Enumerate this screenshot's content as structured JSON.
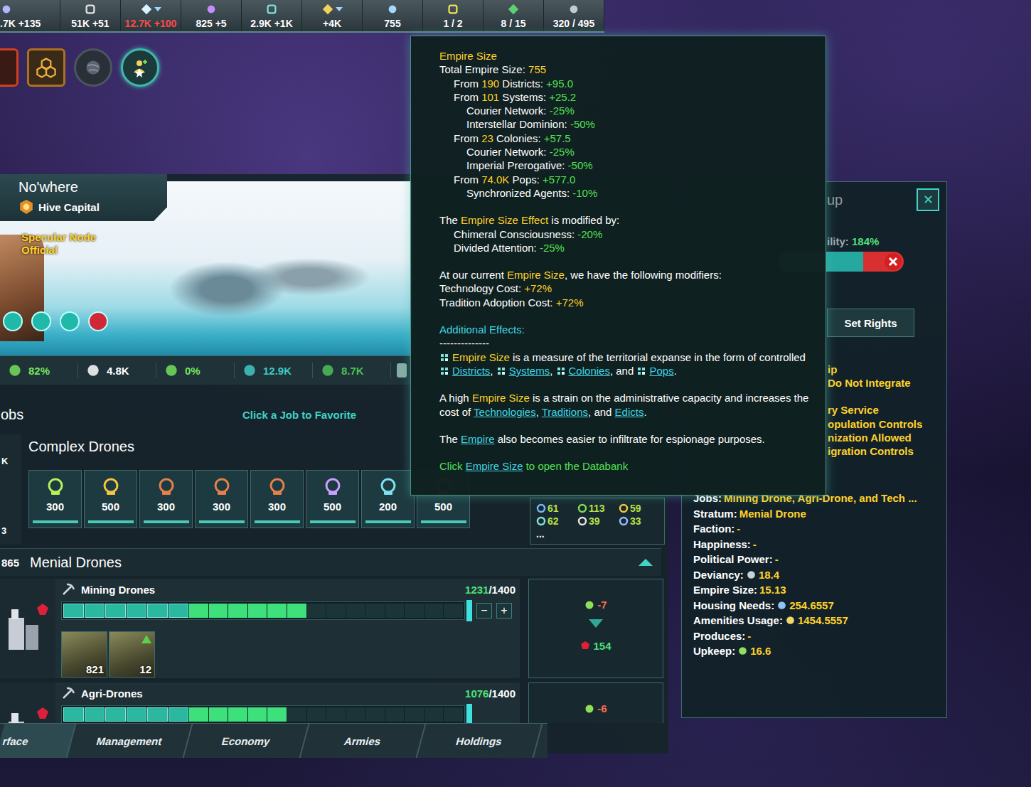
{
  "resources": [
    {
      "text": ".7K +135",
      "warning": false,
      "dropdown": false
    },
    {
      "text": "51K +51",
      "warning": false,
      "dropdown": false
    },
    {
      "text": "12.7K +100",
      "warning": true,
      "dropdown": true
    },
    {
      "text": "825 +5",
      "warning": false,
      "dropdown": false
    },
    {
      "text": "2.9K +1K",
      "warning": false,
      "dropdown": false
    },
    {
      "text": "+4K",
      "warning": false,
      "dropdown": true
    },
    {
      "text": "755",
      "warning": false,
      "dropdown": false
    },
    {
      "text": "1 / 2",
      "warning": false,
      "dropdown": false
    },
    {
      "text": "8 / 15",
      "warning": false,
      "dropdown": false
    },
    {
      "text": "320 / 495",
      "warning": false,
      "dropdown": false
    }
  ],
  "planet": {
    "name": "No'where",
    "designation": "Hive Capital",
    "leader": "Specular Node Official",
    "stats": [
      {
        "text": "82%",
        "color": "#74e25c"
      },
      {
        "text": "4.8K",
        "color": "#ffffff"
      },
      {
        "text": "0%",
        "color": "#74e25c"
      },
      {
        "text": "12.9K",
        "color": "#3fc8c4"
      },
      {
        "text": "8.7K",
        "color": "#4cbf55"
      }
    ]
  },
  "jobs": {
    "title": "obs",
    "hint": "Click a Job to Favorite",
    "side_marks": [
      "K",
      "3"
    ]
  },
  "complex_drones": {
    "title": "Complex Drones",
    "jobs": [
      {
        "count": "300",
        "level": 1
      },
      {
        "count": "500",
        "level": 1
      },
      {
        "count": "300",
        "level": 1
      },
      {
        "count": "300",
        "level": 1
      },
      {
        "count": "300",
        "level": 1
      },
      {
        "count": "500",
        "level": 1
      },
      {
        "count": "200",
        "level": 1
      },
      {
        "count": "500",
        "level": 1
      }
    ],
    "summary": [
      {
        "text": "61",
        "icon": true
      },
      {
        "text": "113",
        "icon": true
      },
      {
        "text": "59",
        "icon": true
      },
      {
        "text": "62",
        "icon": true
      },
      {
        "text": "39",
        "icon": true
      },
      {
        "text": "33",
        "icon": true
      },
      {
        "text": "...",
        "icon": false
      }
    ]
  },
  "menial_drones": {
    "count": "865",
    "title": "Menial Drones",
    "expanded": true,
    "rows": [
      {
        "name": "Mining Drones",
        "filled": "1231",
        "capacity": "/1400",
        "level": 0.6,
        "core_level": 0.3,
        "minus": "−",
        "plus": "+",
        "pops": [
          {
            "count": "821",
            "promoted": false
          },
          {
            "count": "12",
            "promoted": true
          }
        ],
        "upkeep": "-7",
        "output": "154"
      },
      {
        "name": "Agri-Drones",
        "filled": "1076",
        "capacity": "/1400",
        "level": 0.55,
        "core_level": 0.3,
        "pops": [],
        "upkeep": "-6"
      }
    ]
  },
  "tabs": [
    {
      "label": "rface",
      "selected": true
    },
    {
      "label": "Management",
      "selected": false
    },
    {
      "label": "Economy",
      "selected": false
    },
    {
      "label": "Armies",
      "selected": false
    },
    {
      "label": "Holdings",
      "selected": false
    }
  ],
  "pop_group": {
    "close": "✕",
    "title_fragment": "up",
    "habitability_label": "ility: ",
    "habitability_value": "184%",
    "habitability_level": 0.68,
    "rights_button": "Set Rights",
    "policy_fragments": [
      "ip",
      "Do Not Integrate",
      "ry Service",
      "opulation Controls",
      "nization Allowed",
      "igration Controls"
    ],
    "details": [
      {
        "label": "Jobs: ",
        "value": "Mining Drone, Agri-Drone, and Tech ..."
      },
      {
        "label": "Stratum: ",
        "value": "Menial Drone"
      },
      {
        "label": "Faction: ",
        "value": "-"
      },
      {
        "label": "Happiness: ",
        "value": "-"
      },
      {
        "label": "Political Power: ",
        "value": "-"
      },
      {
        "label": "Deviancy: ",
        "value": "18.4"
      },
      {
        "label": "Empire Size: ",
        "value": "15.13"
      },
      {
        "label": "Housing Needs: ",
        "value": "254.6557"
      },
      {
        "label": "Amenities Usage: ",
        "value": "1454.5557"
      },
      {
        "label": "Produces: ",
        "value": "-"
      },
      {
        "label": "Upkeep: ",
        "value": "16.6"
      }
    ]
  },
  "tooltip": {
    "sections": [
      [
        {
          "depth": 0,
          "segs": [
            [
              "hl",
              "Empire Size"
            ]
          ]
        },
        {
          "depth": 0,
          "segs": [
            [
              "t",
              "Total Empire Size: "
            ],
            [
              "hl",
              "755"
            ]
          ]
        },
        {
          "depth": 1,
          "segs": [
            [
              "t",
              "From "
            ],
            [
              "hl",
              "190"
            ],
            [
              "t",
              " Districts: "
            ],
            [
              "num",
              "+95.0"
            ]
          ]
        },
        {
          "depth": 1,
          "segs": [
            [
              "t",
              "From "
            ],
            [
              "hl",
              "101"
            ],
            [
              "t",
              " Systems: "
            ],
            [
              "num",
              "+25.2"
            ]
          ]
        },
        {
          "depth": 2,
          "segs": [
            [
              "t",
              "Courier Network: "
            ],
            [
              "num",
              "-25%"
            ]
          ]
        },
        {
          "depth": 2,
          "segs": [
            [
              "t",
              "Interstellar Dominion: "
            ],
            [
              "num",
              "-50%"
            ]
          ]
        },
        {
          "depth": 1,
          "segs": [
            [
              "t",
              "From "
            ],
            [
              "hl",
              "23"
            ],
            [
              "t",
              " Colonies: "
            ],
            [
              "num",
              "+57.5"
            ]
          ]
        },
        {
          "depth": 2,
          "segs": [
            [
              "t",
              "Courier Network: "
            ],
            [
              "num",
              "-25%"
            ]
          ]
        },
        {
          "depth": 2,
          "segs": [
            [
              "t",
              "Imperial Prerogative: "
            ],
            [
              "num",
              "-50%"
            ]
          ]
        },
        {
          "depth": 1,
          "segs": [
            [
              "t",
              "From "
            ],
            [
              "hl",
              "74.0K"
            ],
            [
              "t",
              " Pops: "
            ],
            [
              "num",
              "+577.0"
            ]
          ]
        },
        {
          "depth": 2,
          "segs": [
            [
              "t",
              "Synchronized Agents: "
            ],
            [
              "num",
              "-10%"
            ]
          ]
        }
      ],
      [
        {
          "depth": 0,
          "segs": [
            [
              "t",
              "The "
            ],
            [
              "hl",
              "Empire Size Effect"
            ],
            [
              "t",
              " is modified by:"
            ]
          ]
        },
        {
          "depth": 1,
          "segs": [
            [
              "t",
              "Chimeral Consciousness: "
            ],
            [
              "num",
              "-20%"
            ]
          ]
        },
        {
          "depth": 1,
          "segs": [
            [
              "t",
              "Divided Attention: "
            ],
            [
              "num",
              "-25%"
            ]
          ]
        }
      ],
      [
        {
          "depth": 0,
          "segs": [
            [
              "t",
              "At our current "
            ],
            [
              "hl",
              "Empire Size"
            ],
            [
              "t",
              ", we have the following modifiers:"
            ]
          ]
        },
        {
          "depth": 0,
          "segs": [
            [
              "t",
              "Technology Cost: "
            ],
            [
              "hl",
              "+72%"
            ]
          ]
        },
        {
          "depth": 0,
          "segs": [
            [
              "t",
              "Tradition Adoption Cost: "
            ],
            [
              "hl",
              "+72%"
            ]
          ]
        }
      ],
      [
        {
          "depth": 0,
          "segs": [
            [
              "head",
              "Additional Effects:"
            ]
          ]
        },
        {
          "depth": 0,
          "segs": [
            [
              "t",
              "--------------"
            ]
          ]
        },
        {
          "depth": 0,
          "segs": [
            [
              "icon"
            ],
            [
              "hl",
              "Empire Size"
            ],
            [
              "t",
              " is a measure of the territorial expanse in the form of controlled "
            ],
            [
              "icon"
            ],
            [
              "link",
              "Districts"
            ],
            [
              "t",
              ", "
            ],
            [
              "icon"
            ],
            [
              "link",
              "Systems"
            ],
            [
              "t",
              ", "
            ],
            [
              "icon"
            ],
            [
              "link",
              "Colonies"
            ],
            [
              "t",
              ", and "
            ],
            [
              "icon"
            ],
            [
              "link",
              "Pops"
            ],
            [
              "t",
              "."
            ]
          ]
        }
      ],
      [
        {
          "depth": 0,
          "segs": [
            [
              "t",
              "A high "
            ],
            [
              "hl",
              "Empire Size"
            ],
            [
              "t",
              " is a strain on the administrative capacity and increases the cost of "
            ],
            [
              "link",
              "Technologies"
            ],
            [
              "t",
              ", "
            ],
            [
              "link",
              "Traditions"
            ],
            [
              "t",
              ", and "
            ],
            [
              "link",
              "Edicts"
            ],
            [
              "t",
              "."
            ]
          ]
        }
      ],
      [
        {
          "depth": 0,
          "segs": [
            [
              "t",
              "The "
            ],
            [
              "link",
              "Empire"
            ],
            [
              "t",
              " also becomes easier to infiltrate for espionage purposes."
            ]
          ]
        }
      ],
      [
        {
          "depth": 0,
          "segs": [
            [
              "num",
              "Click "
            ],
            [
              "link",
              "Empire Size"
            ],
            [
              "num",
              " to open the Databank"
            ]
          ]
        }
      ]
    ]
  }
}
